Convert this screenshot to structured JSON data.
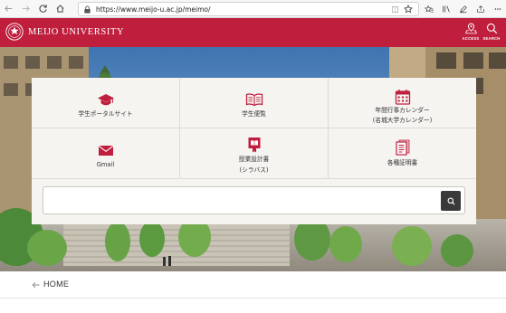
{
  "browser": {
    "url": "https://www.meijo-u.ac.jp/meimo/"
  },
  "header": {
    "brand": "MEIJO UNIVERSITY",
    "access_label": "ACCESS",
    "search_label": "SEARCH",
    "brand_color": "#bf1e3d"
  },
  "menu": {
    "items": [
      {
        "label": "学生ポータルサイト",
        "icon": "graduation-cap-icon"
      },
      {
        "label": "学生便覧",
        "icon": "open-book-icon"
      },
      {
        "label_line1": "年間行事カレンダー",
        "label_line2": "(名城大学カレンダー)",
        "icon": "calendar-icon"
      },
      {
        "label": "Gmail",
        "icon": "mail-icon"
      },
      {
        "label_line1": "授業設計書",
        "label_line2": "(シラバス)",
        "icon": "syllabus-book-icon"
      },
      {
        "label": "各種証明書",
        "icon": "certificate-icon"
      }
    ],
    "accent_color": "#bf1e3d"
  },
  "search": {
    "placeholder": "",
    "value": ""
  },
  "breadcrumb": {
    "home": "HOME"
  }
}
